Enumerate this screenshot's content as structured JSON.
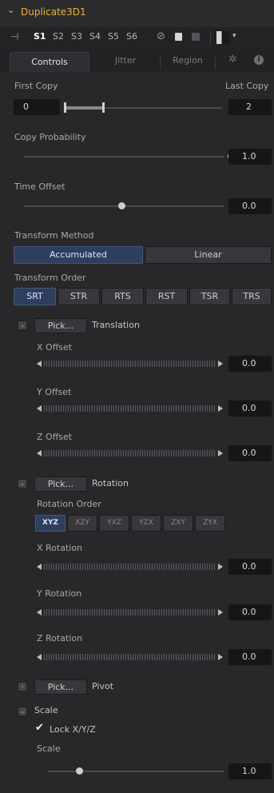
{
  "header": {
    "title": "Duplicate3D1"
  },
  "toolbar": {
    "pin": "⊣",
    "slots": [
      "S1",
      "S2",
      "S3",
      "S4",
      "S5",
      "S6"
    ],
    "disable_glyph": "⊘",
    "lock_glyph": "🔒"
  },
  "tabs": {
    "controls": "Controls",
    "jitter": "Jitter",
    "region": "Region"
  },
  "copies": {
    "first_label": "First Copy",
    "last_label": "Last Copy",
    "first_value": "0",
    "last_value": "2"
  },
  "copy_probability": {
    "label": "Copy Probability",
    "value": "1.0"
  },
  "time_offset": {
    "label": "Time Offset",
    "value": "0.0"
  },
  "transform_method": {
    "label": "Transform Method",
    "options": [
      "Accumulated",
      "Linear"
    ],
    "selected": "Accumulated"
  },
  "transform_order": {
    "label": "Transform Order",
    "options": [
      "SRT",
      "STR",
      "RTS",
      "RST",
      "TSR",
      "TRS"
    ],
    "selected": "SRT"
  },
  "translation": {
    "pick": "Pick...",
    "label": "Translation",
    "x": {
      "label": "X Offset",
      "value": "0.0"
    },
    "y": {
      "label": "Y Offset",
      "value": "0.0"
    },
    "z": {
      "label": "Z Offset",
      "value": "0.0"
    }
  },
  "rotation": {
    "pick": "Pick...",
    "label": "Rotation",
    "order_label": "Rotation Order",
    "order_options": [
      "XYZ",
      "XZY",
      "YXZ",
      "YZX",
      "ZXY",
      "ZYX"
    ],
    "order_selected": "XYZ",
    "x": {
      "label": "X Rotation",
      "value": "0.0"
    },
    "y": {
      "label": "Y Rotation",
      "value": "0.0"
    },
    "z": {
      "label": "Z Rotation",
      "value": "0.0"
    }
  },
  "pivot": {
    "pick": "Pick...",
    "label": "Pivot"
  },
  "scale": {
    "section_label": "Scale",
    "lock_label": "Lock X/Y/Z",
    "lock_checked": true,
    "label": "Scale",
    "value": "1.0"
  },
  "colors": {
    "accent": "#e8b33a",
    "selected": "#2d3e5e",
    "background": "#28282b"
  }
}
